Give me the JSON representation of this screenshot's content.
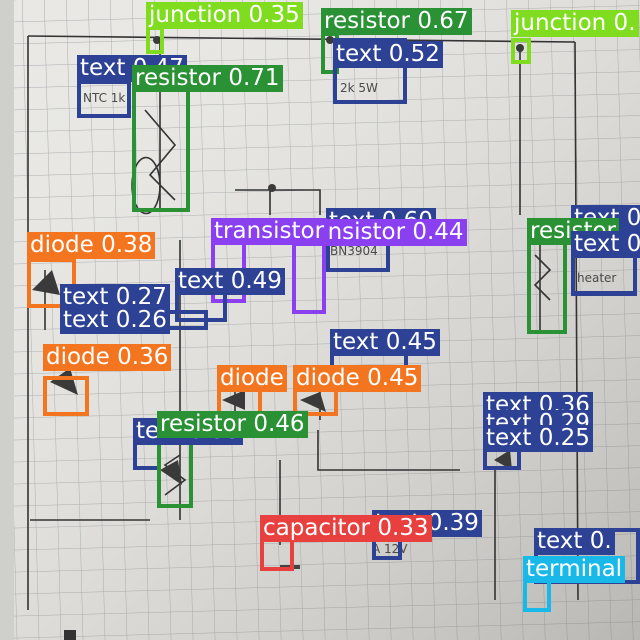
{
  "class_colors": {
    "junction": "#7fdc1f",
    "resistor": "#2a9135",
    "text": "#2d4294",
    "diode": "#f4751f",
    "transistor": "#8a3ff0",
    "capacitor": "#e8403e",
    "terminal": "#18b8e8"
  },
  "detections": [
    {
      "cls": "junction",
      "label": "junction 0.35"
    },
    {
      "cls": "resistor",
      "label": "resistor 0.67"
    },
    {
      "cls": "junction",
      "label": "junction 0."
    },
    {
      "cls": "text",
      "label": "text 0.47"
    },
    {
      "cls": "text",
      "label": "text 0.52"
    },
    {
      "cls": "resistor",
      "label": "resistor 0.71"
    },
    {
      "cls": "text",
      "label": "text 0."
    },
    {
      "cls": "text",
      "label": "text 0.60"
    },
    {
      "cls": "transistor",
      "label": "transistor 0.44"
    },
    {
      "cls": "resistor",
      "label": "resistor"
    },
    {
      "cls": "text",
      "label": "text 0."
    },
    {
      "cls": "transistor",
      "label": "transistor"
    },
    {
      "cls": "diode",
      "label": "diode 0.38"
    },
    {
      "cls": "text",
      "label": "text 0.49"
    },
    {
      "cls": "text",
      "label": "text 0.27"
    },
    {
      "cls": "text",
      "label": "text 0.26"
    },
    {
      "cls": "text",
      "label": "text 0.45"
    },
    {
      "cls": "diode",
      "label": "diode 0.36"
    },
    {
      "cls": "diode",
      "label": "diode"
    },
    {
      "cls": "diode",
      "label": "diode 0.45"
    },
    {
      "cls": "text",
      "label": "text 0.36"
    },
    {
      "cls": "text",
      "label": "text 0.29"
    },
    {
      "cls": "text",
      "label": "text 0.25"
    },
    {
      "cls": "text",
      "label": "text 0.38"
    },
    {
      "cls": "resistor",
      "label": "resistor 0.46"
    },
    {
      "cls": "text",
      "label": "text 0.39"
    },
    {
      "cls": "capacitor",
      "label": "capacitor 0.33"
    },
    {
      "cls": "text",
      "label": "text 0."
    },
    {
      "cls": "terminal",
      "label": "terminal"
    }
  ]
}
